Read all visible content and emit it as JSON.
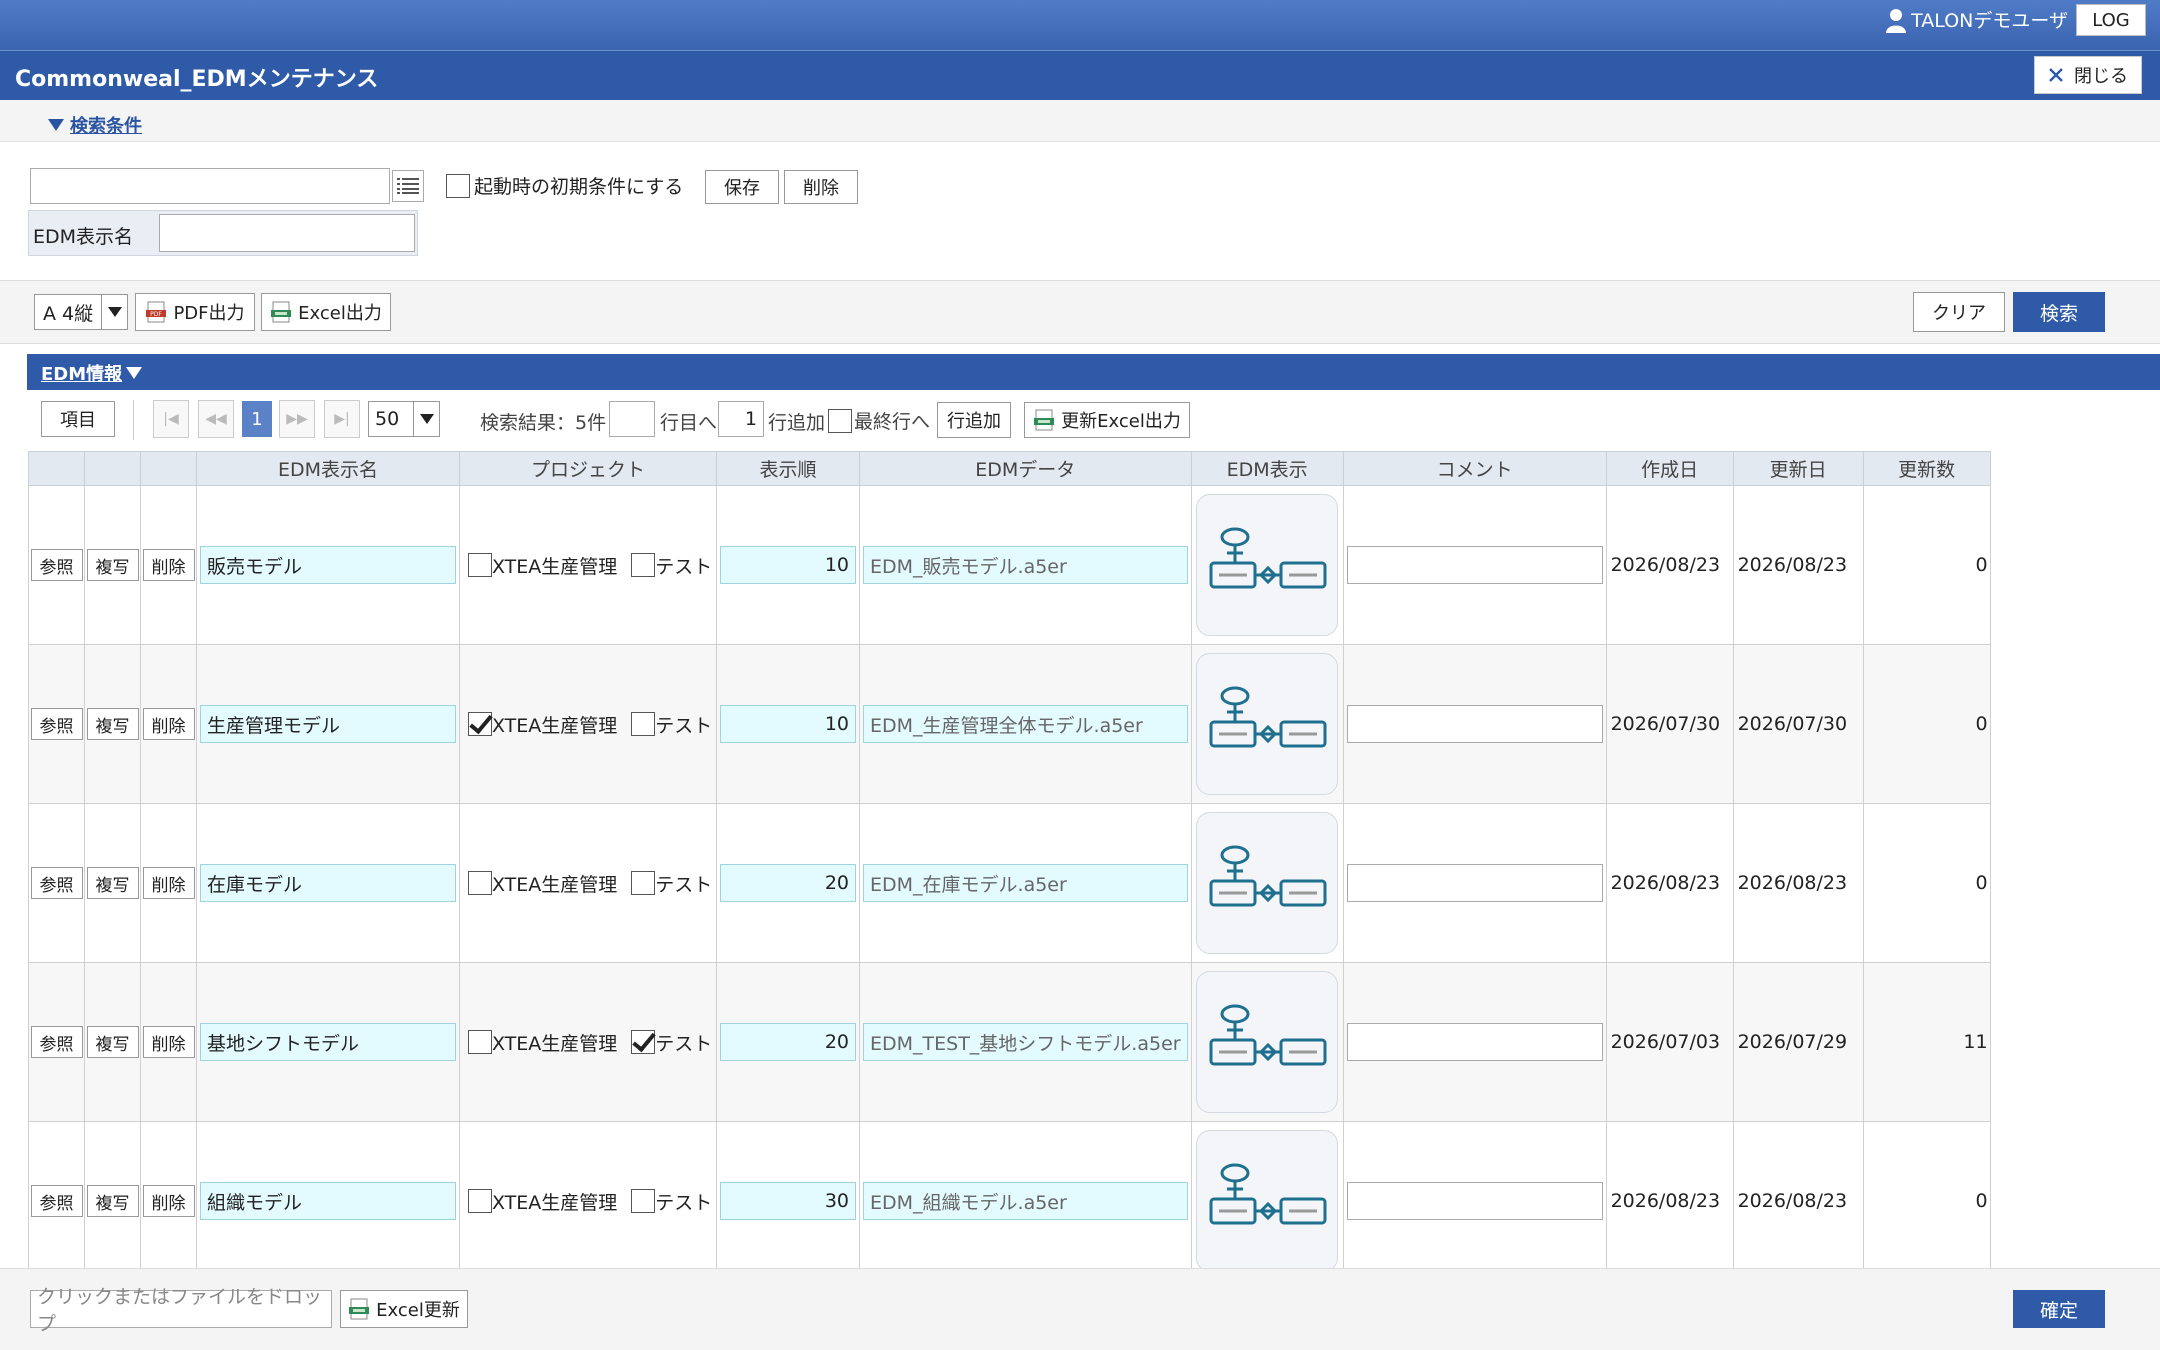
{
  "header": {
    "user_name": "TALONデモユーザ",
    "log_label": "LOG",
    "title": "Commonweal_EDMメンテナンス",
    "close_label": "閉じる"
  },
  "search": {
    "toggle_label": "検索条件",
    "condition_value": "",
    "initial_condition_label": "起動時の初期条件にする",
    "save_label": "保存",
    "delete_label": "削除",
    "edm_name_label": "EDM表示名",
    "edm_name_value": ""
  },
  "toolbar": {
    "paper_size": "A 4縦",
    "pdf_label": "PDF出力",
    "excel_label": "Excel出力",
    "clear_label": "クリア",
    "search_label": "検索"
  },
  "section": {
    "title": "EDM情報"
  },
  "pager": {
    "items_label": "項目",
    "current_page": "1",
    "per_page": "50",
    "result_text": "検索結果：5件",
    "goto_value": "",
    "goto_label": "行目へ",
    "add_count": "1",
    "add_count_label": "行追加",
    "last_row_label": "最終行へ",
    "add_row_label": "行追加",
    "update_excel_label": "更新Excel出力"
  },
  "table": {
    "headers": [
      "",
      "",
      "",
      "EDM表示名",
      "プロジェクト",
      "表示順",
      "EDMデータ",
      "EDM表示",
      "コメント",
      "作成日",
      "更新日",
      "更新数"
    ],
    "ref_label": "参照",
    "copy_label": "複写",
    "delete_label": "削除",
    "project1_label": "XTEA生産管理",
    "project2_label": "テスト",
    "rows": [
      {
        "name": "販売モデル",
        "p1": false,
        "p2": false,
        "order": "10",
        "file": "EDM_販売モデル.a5er",
        "comment": "",
        "created": "2026/08/23",
        "updated": "2026/08/23",
        "count": "0"
      },
      {
        "name": "生産管理モデル",
        "p1": true,
        "p2": false,
        "order": "10",
        "file": "EDM_生産管理全体モデル.a5er",
        "comment": "",
        "created": "2026/07/30",
        "updated": "2026/07/30",
        "count": "0"
      },
      {
        "name": "在庫モデル",
        "p1": false,
        "p2": false,
        "order": "20",
        "file": "EDM_在庫モデル.a5er",
        "comment": "",
        "created": "2026/08/23",
        "updated": "2026/08/23",
        "count": "0"
      },
      {
        "name": "基地シフトモデル",
        "p1": false,
        "p2": true,
        "order": "20",
        "file": "EDM_TEST_基地シフトモデル.a5er",
        "comment": "",
        "created": "2026/07/03",
        "updated": "2026/07/29",
        "count": "11"
      },
      {
        "name": "組織モデル",
        "p1": false,
        "p2": false,
        "order": "30",
        "file": "EDM_組織モデル.a5er",
        "comment": "",
        "created": "2026/08/23",
        "updated": "2026/08/23",
        "count": "0"
      }
    ]
  },
  "footer": {
    "drop_placeholder": "クリックまたはファイルをドロップ",
    "excel_update_label": "Excel更新",
    "confirm_label": "確定"
  },
  "colors": {
    "primary": "#2e5aa8",
    "cell_highlight": "#e3fbff",
    "icon_teal": "#1f6f8f"
  }
}
